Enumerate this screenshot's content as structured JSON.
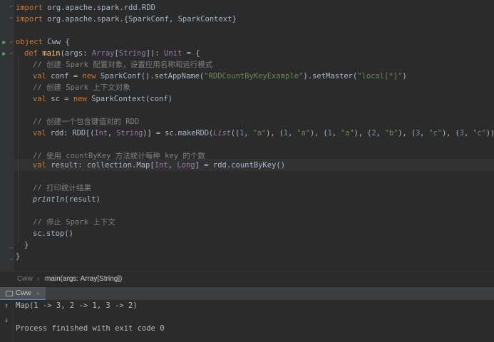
{
  "editor": {
    "lines": {
      "l1": {
        "kw": "import",
        "rest": " org.apache.spark.rdd.RDD"
      },
      "l2": {
        "kw": "import",
        "rest": " org.apache.spark.{SparkConf, SparkContext}"
      },
      "l4": {
        "kw": "object",
        "rest": " Cww {"
      },
      "l5": {
        "kw": "def",
        "fn": "main",
        "p1": "(args: ",
        "ty1": "Array",
        "p2": "[",
        "ty2": "String",
        "p3": "]): ",
        "ty3": "Unit",
        "p4": " = {"
      },
      "l6": {
        "cm": "// 创建 Spark 配置对象，设置应用名称和运行模式"
      },
      "l7": {
        "kw1": "val",
        "p1": " conf = ",
        "kw2": "new",
        "p2": " SparkConf().setAppName(",
        "s1": "\"RDDCountByKeyExample\"",
        "p3": ").setMaster(",
        "s2": "\"local[*]\"",
        "p4": ")"
      },
      "l8": {
        "cm": "// 创建 Spark 上下文对象"
      },
      "l9": {
        "kw1": "val",
        "p1": " sc = ",
        "kw2": "new",
        "p2": " SparkContext(conf)"
      },
      "l11": {
        "cm": "// 创建一个包含键值对的 RDD"
      },
      "l12": {
        "kw": "val",
        "p1": " rdd: RDD[(",
        "ty1": "Int",
        "p2": ", ",
        "ty2": "String",
        "p3": ")] = sc.makeRDD(",
        "it": "List",
        "p4": "((",
        "n1": "1",
        "p5": ", ",
        "s1": "\"a\"",
        "p6": "), (",
        "n2": "1",
        "p7": ", ",
        "s2": "\"a\"",
        "p8": "), (",
        "n3": "1",
        "p9": ", ",
        "s3": "\"a\"",
        "p10": "), (",
        "n4": "2",
        "p11": ", ",
        "s4": "\"b\"",
        "p12": "), (",
        "n5": "3",
        "p13": ", ",
        "s5": "\"c\"",
        "p14": "), (",
        "n6": "3",
        "p15": ", ",
        "s6": "\"c\"",
        "p16": ")))"
      },
      "l14": {
        "cm": "// 使用 countByKey 方法统计每种 key 的个数"
      },
      "l15": {
        "kw": "val",
        "p1": " result: collection.Map[",
        "ty1": "Int",
        "p2": ", ",
        "ty2": "Long",
        "p3": "] = rdd.countByKey()"
      },
      "l17": {
        "cm": "// 打印统计结果"
      },
      "l18": {
        "it": "println",
        "p1": "(result)"
      },
      "l20": {
        "cm": "// 停止 Spark 上下文"
      },
      "l21": {
        "p1": "sc.stop()"
      },
      "l22": {
        "p1": "}"
      },
      "l23": {
        "p1": "}"
      }
    }
  },
  "breadcrumbs": {
    "item1": "Cww",
    "separator": "›",
    "item2": "main(args: Array[String])"
  },
  "run_panel": {
    "tab_label": "Cww",
    "close_glyph": "×"
  },
  "console": {
    "output1": "Map(1 -> 3, 2 -> 1, 3 -> 2)",
    "output2": "Process finished with exit code 0"
  },
  "icons": {
    "run": "run-icon",
    "fold": "fold-icon",
    "scroll_up": "arrow-up-icon",
    "scroll_down": "arrow-down-icon"
  }
}
